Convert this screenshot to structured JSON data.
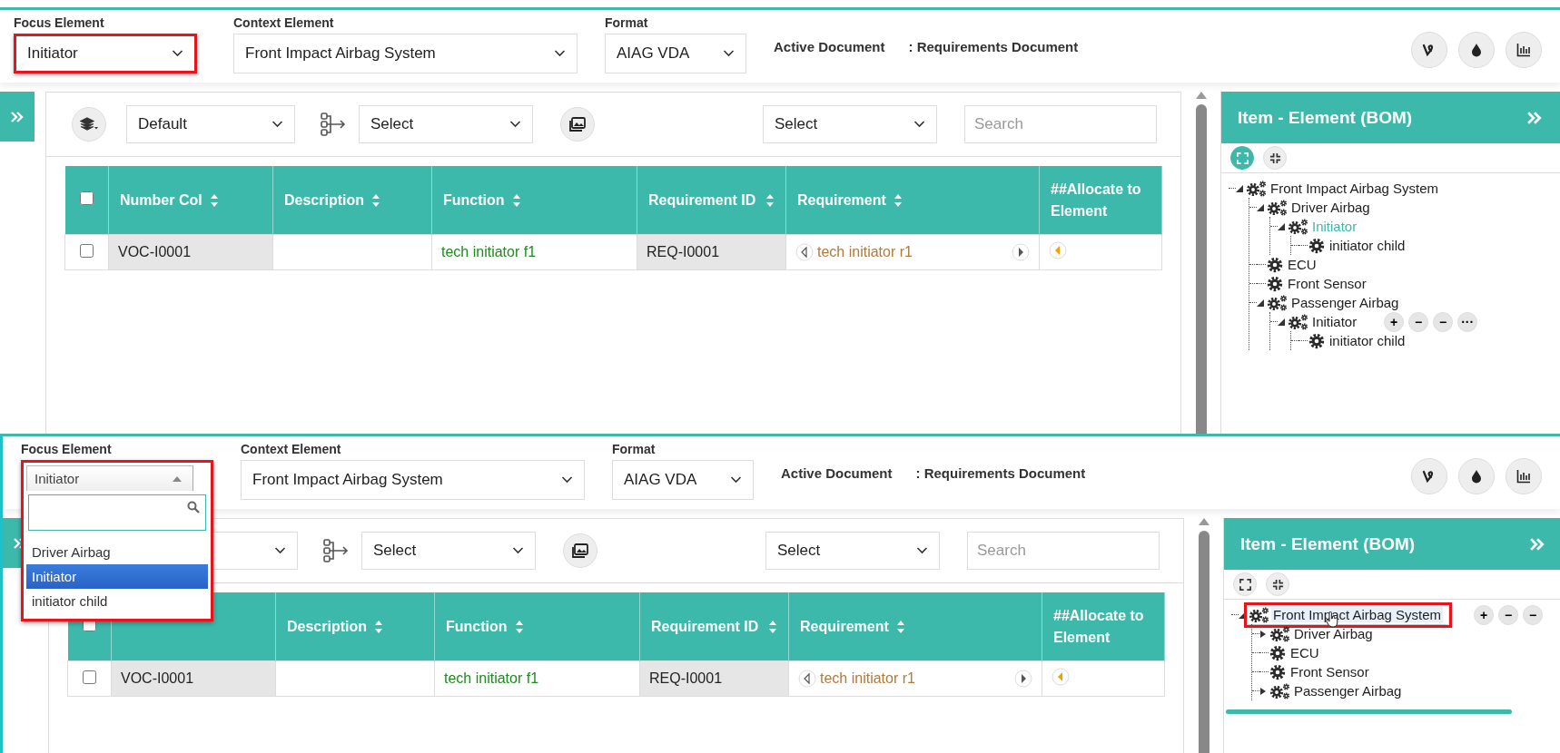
{
  "panels": [
    {
      "focus": {
        "label": "Focus Element",
        "value": "Initiator",
        "open": false,
        "annotated": true
      },
      "context": {
        "label": "Context Element",
        "value": "Front Impact Airbag System"
      },
      "format": {
        "label": "Format",
        "value": "AIAG VDA"
      },
      "active_document": {
        "label": "Active Document",
        "value": ": Requirements Document"
      },
      "toolbar": {
        "view": "Default",
        "hierarchy": "Select",
        "filter": "Select",
        "search_placeholder": "Search"
      },
      "table": {
        "columns": [
          {
            "kind": "checkbox",
            "checked": false
          },
          {
            "kind": "text",
            "label": "Number Col",
            "sortable": true
          },
          {
            "kind": "text",
            "label": "Description",
            "sortable": true
          },
          {
            "kind": "text",
            "label": "Function",
            "sortable": true
          },
          {
            "kind": "text",
            "label": "Requirement ID",
            "sortable": true
          },
          {
            "kind": "text",
            "label": "Requirement",
            "sortable": true
          },
          {
            "kind": "text",
            "label": "##Allocate to Element",
            "sortable": false
          }
        ],
        "rows": [
          {
            "cells": [
              {
                "kind": "checkbox",
                "checked": false
              },
              {
                "kind": "key",
                "text": "VOC-I0001"
              },
              {
                "kind": "plain"
              },
              {
                "kind": "function",
                "text": "tech initiator f1"
              },
              {
                "kind": "key",
                "text": "REQ-I0001"
              },
              {
                "kind": "requirement",
                "text": "tech initiator r1"
              },
              {
                "kind": "allocate"
              }
            ]
          }
        ]
      },
      "tree": {
        "title": "Item - Element (BOM)",
        "expand_all_selected": true,
        "scrollbar": false,
        "nodes": [
          {
            "label": "Front Impact Airbag System",
            "kind": "group",
            "expanded": true,
            "selected": false,
            "hovered": false,
            "annotated": false,
            "children": [
              {
                "label": "Driver Airbag",
                "kind": "group",
                "expanded": true,
                "selected": false,
                "hovered": false,
                "annotated": false,
                "children": [
                  {
                    "label": "Initiator",
                    "kind": "group",
                    "expanded": true,
                    "selected": true,
                    "hovered": false,
                    "annotated": false,
                    "children": [
                      {
                        "label": "initiator child",
                        "kind": "leaf",
                        "selected": false,
                        "hovered": false,
                        "annotated": false
                      }
                    ]
                  }
                ]
              },
              {
                "label": "ECU",
                "kind": "leaf",
                "selected": false,
                "hovered": false,
                "annotated": false
              },
              {
                "label": "Front Sensor",
                "kind": "leaf",
                "selected": false,
                "hovered": false,
                "annotated": false
              },
              {
                "label": "Passenger Airbag",
                "kind": "group",
                "expanded": true,
                "selected": false,
                "hovered": false,
                "annotated": false,
                "children": [
                  {
                    "label": "Initiator",
                    "kind": "group",
                    "expanded": true,
                    "selected": false,
                    "hovered": false,
                    "annotated": false,
                    "actions": [
                      "+",
                      "−",
                      "−",
                      "···"
                    ],
                    "children": [
                      {
                        "label": "initiator child",
                        "kind": "leaf",
                        "selected": false,
                        "hovered": false,
                        "annotated": false
                      }
                    ]
                  }
                ]
              }
            ]
          }
        ]
      }
    },
    {
      "focus": {
        "label": "Focus Element",
        "value": "Initiator",
        "open": true,
        "annotated": true,
        "options": [
          {
            "label": "Driver Airbag",
            "selected": false
          },
          {
            "label": "Initiator",
            "selected": true
          },
          {
            "label": "initiator child",
            "selected": false
          }
        ]
      },
      "context": {
        "label": "Context Element",
        "value": "Front Impact Airbag System"
      },
      "format": {
        "label": "Format",
        "value": "AIAG VDA"
      },
      "active_document": {
        "label": "Active Document",
        "value": ": Requirements Document"
      },
      "toolbar": {
        "hierarchy": "Select",
        "filter": "Select",
        "search_placeholder": "Search"
      },
      "table": {
        "columns": [
          {
            "kind": "checkbox",
            "checked": false
          },
          {
            "kind": "text"
          },
          {
            "kind": "text",
            "label": "Description",
            "sortable": true
          },
          {
            "kind": "text",
            "label": "Function",
            "sortable": true
          },
          {
            "kind": "text",
            "label": "Requirement ID",
            "sortable": true
          },
          {
            "kind": "text",
            "label": "Requirement",
            "sortable": true
          },
          {
            "kind": "text",
            "label": "##Allocate to Element",
            "sortable": false
          }
        ],
        "rows": [
          {
            "cells": [
              {
                "kind": "checkbox",
                "checked": false
              },
              {
                "kind": "key",
                "text": "VOC-I0001"
              },
              {
                "kind": "plain"
              },
              {
                "kind": "function",
                "text": "tech initiator f1"
              },
              {
                "kind": "key",
                "text": "REQ-I0001"
              },
              {
                "kind": "requirement",
                "text": "tech initiator r1"
              },
              {
                "kind": "allocate"
              }
            ]
          }
        ]
      },
      "tree": {
        "title": "Item - Element (BOM)",
        "expand_all_selected": false,
        "scrollbar": true,
        "nodes": [
          {
            "label": "Front Impact Airbag System",
            "kind": "group",
            "expanded": true,
            "selected": false,
            "hovered": true,
            "annotated": true,
            "actions": [
              "+",
              "−",
              "−"
            ],
            "children": [
              {
                "label": "Driver Airbag",
                "kind": "group",
                "expanded": false,
                "selected": false,
                "hovered": false,
                "annotated": false
              },
              {
                "label": "ECU",
                "kind": "leaf",
                "selected": false,
                "hovered": false,
                "annotated": false
              },
              {
                "label": "Front Sensor",
                "kind": "leaf",
                "selected": false,
                "hovered": false,
                "annotated": false
              },
              {
                "label": "Passenger Airbag",
                "kind": "group",
                "expanded": false,
                "selected": false,
                "hovered": false,
                "annotated": false
              }
            ]
          }
        ]
      }
    }
  ]
}
